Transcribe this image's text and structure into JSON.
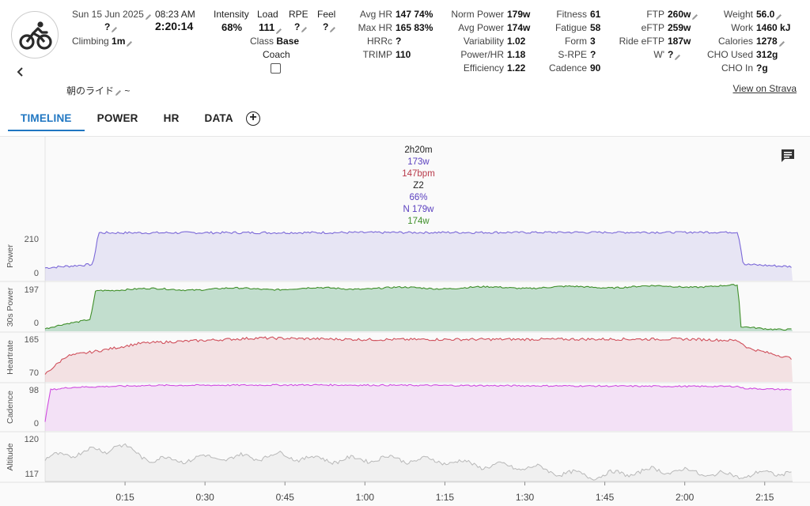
{
  "header": {
    "date": "Sun 15 Jun 2025",
    "time": "08:23 AM",
    "date_value": "?",
    "duration": "2:20:14",
    "climbing_label": "Climbing",
    "climbing_value": "1m",
    "intensity_label": "Intensity",
    "intensity_value": "68%",
    "load_label": "Load",
    "load_value": "111",
    "rpe_label": "RPE",
    "rpe_value": "?",
    "feel_label": "Feel",
    "feel_value": "?",
    "class_label": "Class",
    "class_value": "Base",
    "coach_label": "Coach",
    "activity_title": "朝のライド",
    "activity_title_suffix": "~",
    "view_on_strava": "View on Strava"
  },
  "stats_col1": [
    {
      "label": "Avg HR",
      "value": "147 74%"
    },
    {
      "label": "Max HR",
      "value": "165 83%"
    },
    {
      "label": "HRRc",
      "value": "?"
    },
    {
      "label": "TRIMP",
      "value": "110"
    }
  ],
  "stats_col2": [
    {
      "label": "Norm Power",
      "value": "179w"
    },
    {
      "label": "Avg Power",
      "value": "174w"
    },
    {
      "label": "Variability",
      "value": "1.02"
    },
    {
      "label": "Power/HR",
      "value": "1.18"
    },
    {
      "label": "Efficiency",
      "value": "1.22"
    }
  ],
  "stats_col3": [
    {
      "label": "Fitness",
      "value": "61"
    },
    {
      "label": "Fatigue",
      "value": "58"
    },
    {
      "label": "Form",
      "value": "3"
    },
    {
      "label": "S-RPE",
      "value": "?"
    },
    {
      "label": "Cadence",
      "value": "90"
    }
  ],
  "stats_col4": [
    {
      "label": "FTP",
      "value": "260w"
    },
    {
      "label": "eFTP",
      "value": "259w"
    },
    {
      "label": "Ride eFTP",
      "value": "187w"
    },
    {
      "label": "W'",
      "value": "?"
    }
  ],
  "stats_col5": [
    {
      "label": "Weight",
      "value": "56.0"
    },
    {
      "label": "Work",
      "value": "1460 kJ"
    },
    {
      "label": "Calories",
      "value": "1278"
    },
    {
      "label": "CHO Used",
      "value": "312g"
    },
    {
      "label": "CHO In",
      "value": "?g"
    }
  ],
  "tabs": [
    {
      "label": "TIMELINE",
      "active": true
    },
    {
      "label": "POWER",
      "active": false
    },
    {
      "label": "HR",
      "active": false
    },
    {
      "label": "DATA",
      "active": false
    }
  ],
  "tooltip": {
    "duration": "2h20m",
    "power": "173w",
    "hr": "147bpm",
    "zone": "Z2",
    "intensity": "66%",
    "norm_power": "N 179w",
    "avg_30s": "174w"
  },
  "colors": {
    "accent": "#1f76c2",
    "power": "#7b68d8",
    "power30": "#3f8f2a",
    "hr": "#d0505c",
    "cadence": "#d04ce0",
    "altitude": "#b8b8b8"
  },
  "chart_data": {
    "type": "line",
    "x_ticks": [
      "0:15",
      "0:30",
      "0:45",
      "1:00",
      "1:15",
      "1:30",
      "1:45",
      "2:00",
      "2:15"
    ],
    "x_tick_minutes": [
      15,
      30,
      45,
      60,
      75,
      90,
      105,
      120,
      135
    ],
    "x_range_minutes": [
      0,
      140.23
    ],
    "panels": [
      {
        "name": "Power",
        "ylim": [
          0,
          210
        ],
        "ticks": [
          "210",
          "0"
        ],
        "color": "#7b68d8",
        "segments": [
          [
            0,
            55
          ],
          [
            9,
            70
          ],
          [
            10,
            205
          ],
          [
            130,
            208
          ],
          [
            131,
            70
          ],
          [
            140.23,
            60
          ]
        ]
      },
      {
        "name": "30s Power",
        "ylim": [
          0,
          197
        ],
        "ticks": [
          "197",
          "0"
        ],
        "color": "#3f8f2a",
        "segments": [
          [
            0,
            10
          ],
          [
            6,
            35
          ],
          [
            8.5,
            50
          ],
          [
            9.5,
            170
          ],
          [
            100,
            180
          ],
          [
            130,
            185
          ],
          [
            130.5,
            15
          ],
          [
            140.23,
            10
          ]
        ]
      },
      {
        "name": "Heartrate",
        "ylim": [
          70,
          165
        ],
        "ticks": [
          "165",
          "70"
        ],
        "color": "#d0505c",
        "segments": [
          [
            0,
            85
          ],
          [
            4,
            120
          ],
          [
            10,
            130
          ],
          [
            18,
            145
          ],
          [
            40,
            155
          ],
          [
            60,
            152
          ],
          [
            120,
            153
          ],
          [
            130,
            150
          ],
          [
            132,
            135
          ],
          [
            140.23,
            115
          ]
        ]
      },
      {
        "name": "Cadence",
        "ylim": [
          0,
          98
        ],
        "ticks": [
          "98",
          "0"
        ],
        "color": "#d04ce0",
        "segments": [
          [
            0,
            20
          ],
          [
            1,
            85
          ],
          [
            5,
            90
          ],
          [
            20,
            94
          ],
          [
            50,
            95
          ],
          [
            120,
            92
          ],
          [
            130,
            92
          ],
          [
            131,
            88
          ],
          [
            140.23,
            85
          ]
        ]
      },
      {
        "name": "Altitude",
        "ylim": [
          116.5,
          120.5
        ],
        "ticks": [
          "120",
          "117"
        ],
        "color": "#b8b8b8",
        "segments": [
          [
            0,
            118.3
          ],
          [
            12,
            119
          ],
          [
            13,
            119.6
          ],
          [
            20,
            118.5
          ],
          [
            35,
            118.2
          ],
          [
            45,
            118.8
          ],
          [
            58,
            118.1
          ],
          [
            75,
            118.4
          ],
          [
            85,
            117.6
          ],
          [
            100,
            117.2
          ],
          [
            140.23,
            117.2
          ]
        ]
      }
    ]
  }
}
